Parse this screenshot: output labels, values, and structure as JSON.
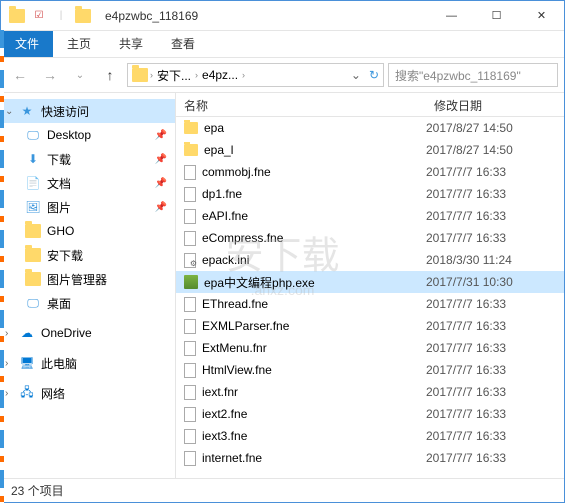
{
  "title": "e4pzwbc_118169",
  "win_controls": {
    "min": "—",
    "max": "☐",
    "close": "✕"
  },
  "ribbon": {
    "file": "文件",
    "home": "主页",
    "share": "共享",
    "view": "查看"
  },
  "nav": {
    "back": "←",
    "fwd": "→",
    "up": "↑",
    "refresh": "↻",
    "dropdown": "⌄"
  },
  "breadcrumb": [
    "安下...",
    "e4pz..."
  ],
  "search_placeholder": "搜索\"e4pzwbc_118169\"",
  "sidebar": {
    "quick": {
      "label": "快速访问",
      "icon": "★"
    },
    "items": [
      {
        "label": "Desktop",
        "icon": "🖵",
        "color": "#3a96dd",
        "pinned": true
      },
      {
        "label": "下载",
        "icon": "⬇",
        "color": "#3a96dd",
        "pinned": true
      },
      {
        "label": "文档",
        "icon": "📄",
        "color": "#3a96dd",
        "pinned": true
      },
      {
        "label": "图片",
        "icon": "🖼",
        "color": "#3a96dd",
        "pinned": true
      },
      {
        "label": "GHO",
        "icon": "folder",
        "pinned": false
      },
      {
        "label": "安下载",
        "icon": "folder",
        "pinned": false
      },
      {
        "label": "图片管理器",
        "icon": "folder",
        "pinned": false
      },
      {
        "label": "桌面",
        "icon": "🖵",
        "color": "#3a96dd",
        "pinned": false
      }
    ],
    "onedrive": "OneDrive",
    "thispc": "此电脑",
    "network": "网络"
  },
  "columns": {
    "name": "名称",
    "date": "修改日期"
  },
  "files": [
    {
      "name": "epa",
      "type": "folder",
      "date": "2017/8/27 14:50"
    },
    {
      "name": "epa_l",
      "type": "folder",
      "date": "2017/8/27 14:50"
    },
    {
      "name": "commobj.fne",
      "type": "doc",
      "date": "2017/7/7 16:33"
    },
    {
      "name": "dp1.fne",
      "type": "doc",
      "date": "2017/7/7 16:33"
    },
    {
      "name": "eAPI.fne",
      "type": "doc",
      "date": "2017/7/7 16:33"
    },
    {
      "name": "eCompress.fne",
      "type": "doc",
      "date": "2017/7/7 16:33"
    },
    {
      "name": "epack.ini",
      "type": "ini",
      "date": "2018/3/30 11:24"
    },
    {
      "name": "epa中文编程php.exe",
      "type": "exe",
      "date": "2017/7/31 10:30",
      "selected": true
    },
    {
      "name": "EThread.fne",
      "type": "doc",
      "date": "2017/7/7 16:33"
    },
    {
      "name": "EXMLParser.fne",
      "type": "doc",
      "date": "2017/7/7 16:33"
    },
    {
      "name": "ExtMenu.fnr",
      "type": "doc",
      "date": "2017/7/7 16:33"
    },
    {
      "name": "HtmlView.fne",
      "type": "doc",
      "date": "2017/7/7 16:33"
    },
    {
      "name": "iext.fnr",
      "type": "doc",
      "date": "2017/7/7 16:33"
    },
    {
      "name": "iext2.fne",
      "type": "doc",
      "date": "2017/7/7 16:33"
    },
    {
      "name": "iext3.fne",
      "type": "doc",
      "date": "2017/7/7 16:33"
    },
    {
      "name": "internet.fne",
      "type": "doc",
      "date": "2017/7/7 16:33"
    }
  ],
  "status": "23 个项目",
  "watermark": "安下载",
  "watermark_sub": ".anxz.com"
}
